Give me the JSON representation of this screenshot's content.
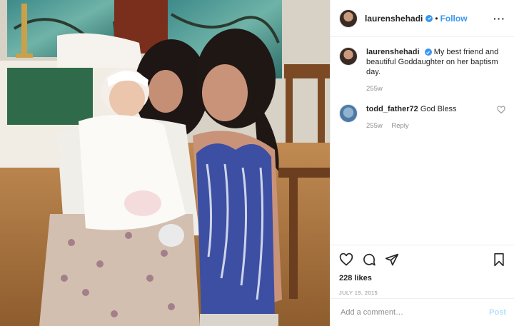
{
  "post": {
    "author": "laurenshehadi",
    "verified": true,
    "follow_dot": "•",
    "follow_label": "Follow",
    "more_label": "···",
    "photo_alt": "Two women holding a baby in a christening gown"
  },
  "caption": {
    "username": "laurenshehadi",
    "text": "My best friend and beautiful Goddaughter on her baptism day.",
    "age": "255w"
  },
  "comments": [
    {
      "username": "todd_father72",
      "text": "God Bless",
      "age": "255w",
      "reply_label": "Reply"
    }
  ],
  "actions": {
    "likes": "228 likes",
    "date": "JULY 19, 2015"
  },
  "comment_box": {
    "placeholder": "Add a comment…",
    "post_label": "Post"
  },
  "colors": {
    "accent": "#3897f0",
    "post_disabled": "#b2dffc",
    "muted": "#8e8e8e"
  }
}
